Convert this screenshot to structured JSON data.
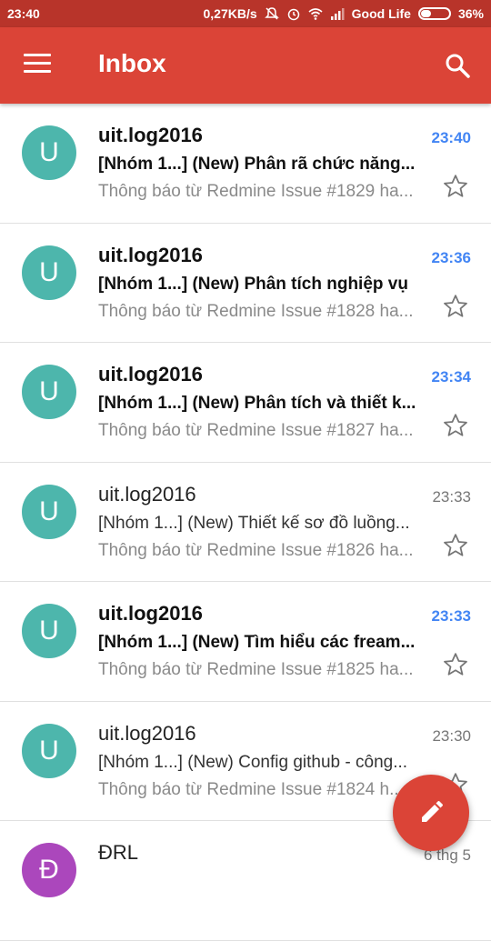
{
  "status_bar": {
    "time": "23:40",
    "network_speed": "0,27KB/s",
    "carrier": "Good Life",
    "battery": "36%",
    "battery_level": 0.36
  },
  "app_bar": {
    "title": "Inbox",
    "menu_icon": "menu-icon",
    "search_icon": "search-icon"
  },
  "colors": {
    "primary": "#db4437",
    "status": "#b8342a",
    "unread_time": "#4285f4",
    "avatar_teal": "#4db6ac",
    "avatar_purple": "#ab47bc"
  },
  "emails": [
    {
      "avatar": "U",
      "sender": "uit.log2016",
      "time": "23:40",
      "subject": "[Nhóm 1...] (New) Phân rã chức năng...",
      "snippet": "Thông báo từ Redmine Issue #1829 ha...",
      "unread": true
    },
    {
      "avatar": "U",
      "sender": "uit.log2016",
      "time": "23:36",
      "subject": "[Nhóm 1...] (New) Phân tích nghiệp vụ",
      "snippet": "Thông báo từ Redmine Issue #1828 ha...",
      "unread": true
    },
    {
      "avatar": "U",
      "sender": "uit.log2016",
      "time": "23:34",
      "subject": "[Nhóm 1...] (New) Phân tích và thiết k...",
      "snippet": "Thông báo từ Redmine Issue #1827 ha...",
      "unread": true
    },
    {
      "avatar": "U",
      "sender": "uit.log2016",
      "time": "23:33",
      "subject": "[Nhóm 1...] (New) Thiết kế sơ đồ luồng...",
      "snippet": "Thông báo từ Redmine Issue #1826 ha...",
      "unread": false
    },
    {
      "avatar": "U",
      "sender": "uit.log2016",
      "time": "23:33",
      "subject": "[Nhóm 1...] (New) Tìm hiểu các fream...",
      "snippet": "Thông báo từ Redmine Issue #1825 ha...",
      "unread": true
    },
    {
      "avatar": "U",
      "sender": "uit.log2016",
      "time": "23:30",
      "subject": "[Nhóm 1...] (New) Config github - công...",
      "snippet": "Thông báo từ Redmine Issue #1824 h...",
      "unread": false
    },
    {
      "avatar": "Đ",
      "sender": "ĐRL",
      "time": "6 thg 5",
      "subject": "",
      "snippet": "",
      "unread": false
    }
  ],
  "fab": {
    "icon": "pencil-icon"
  }
}
